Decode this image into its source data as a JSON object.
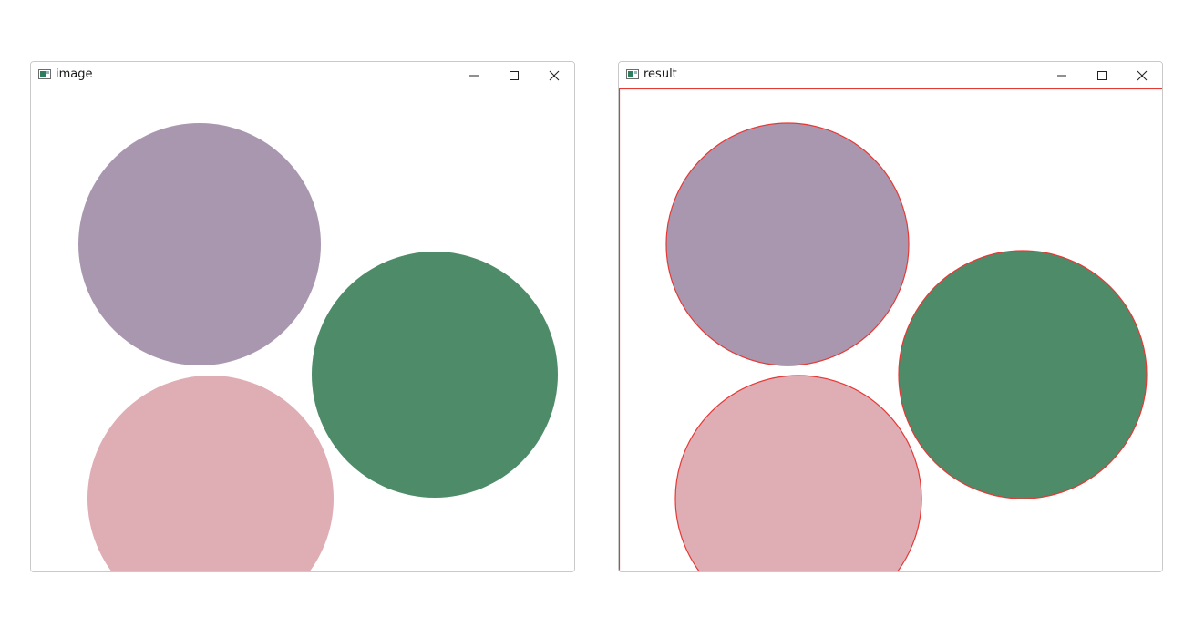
{
  "windows": [
    {
      "title": "image",
      "controls": [
        "minimize-icon",
        "maximize-icon",
        "close-icon"
      ]
    },
    {
      "title": "result",
      "controls": [
        "minimize-icon",
        "maximize-icon",
        "close-icon"
      ]
    }
  ],
  "colors": {
    "purple_circle": "#a997b0",
    "green_circle": "#4e8b69",
    "pink_circle": "#dfadb4",
    "contour": "#e53935",
    "window_border": "#c9c9c9"
  }
}
